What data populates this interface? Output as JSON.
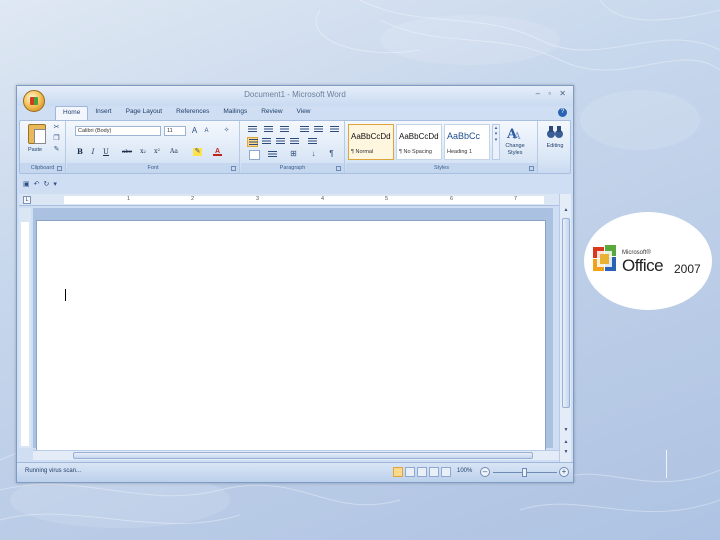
{
  "window": {
    "title": "Document1 - Microsoft Word",
    "controls": "–  ▫  ✕"
  },
  "ribbon_tabs": [
    "Home",
    "Insert",
    "Page Layout",
    "References",
    "Mailings",
    "Review",
    "View"
  ],
  "clipboard": {
    "paste_label": "Paste",
    "group_label": "Clipboard"
  },
  "font": {
    "name": "Calibri (Body)",
    "size": "11",
    "group_label": "Font",
    "buttons": [
      "B",
      "I",
      "U",
      "abe",
      "x₂",
      "x²",
      "Aa"
    ]
  },
  "paragraph": {
    "group_label": "Paragraph"
  },
  "styles": {
    "group_label": "Styles",
    "tiles": [
      {
        "sample": "AaBbCcDd",
        "name": "¶ Normal"
      },
      {
        "sample": "AaBbCcDd",
        "name": "¶ No Spacing"
      },
      {
        "sample": "AaBbCc",
        "name": "Heading 1"
      }
    ],
    "change_styles": "Change Styles",
    "editing": "Editing"
  },
  "ruler": {
    "numbers": [
      "1",
      "2",
      "3",
      "4",
      "5",
      "6",
      "7"
    ]
  },
  "status": {
    "text": "Running virus scan...",
    "zoom": "100%"
  },
  "zoom_level": 1.0,
  "logo": {
    "small": "Microsoft®",
    "main": "Office",
    "year": "2007"
  },
  "colors": {
    "ribbon_accent": "#ffd98a",
    "title_blue": "#22406b",
    "logo_red": "#d9391f",
    "logo_green": "#5aa83b",
    "logo_orange": "#f0a21e",
    "logo_blue": "#2a63b4"
  }
}
